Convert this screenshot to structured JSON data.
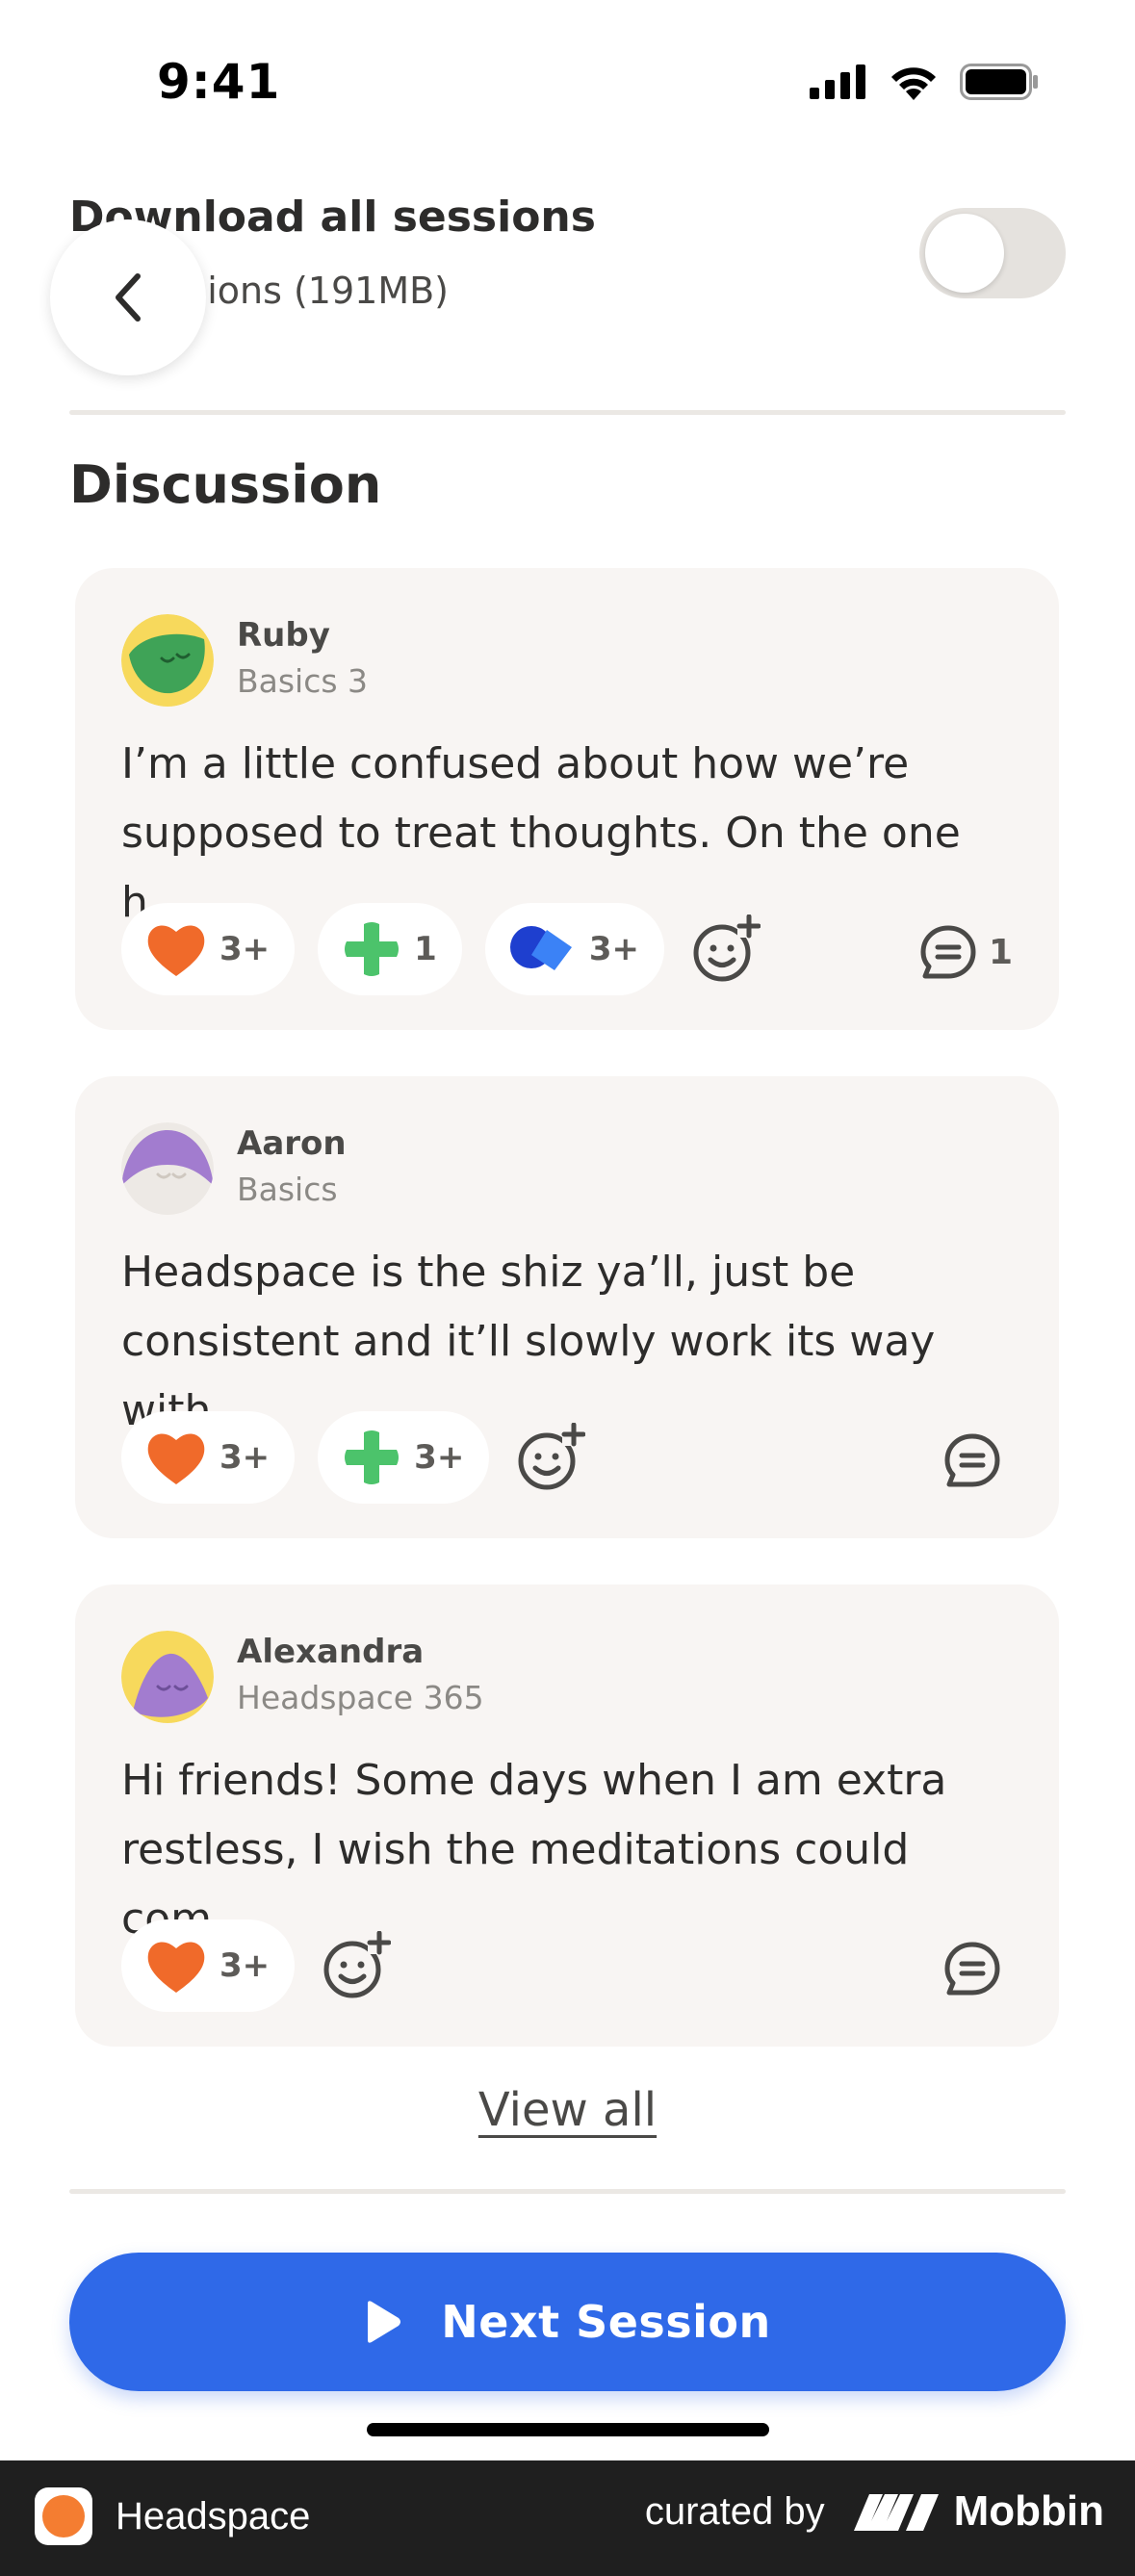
{
  "status_bar": {
    "time": "9:41"
  },
  "download": {
    "title": "Download all sessions",
    "subtitle": "10 sessions (191MB)",
    "toggle_on": false
  },
  "discussion": {
    "title": "Discussion",
    "posts": [
      {
        "author": "Ruby",
        "course": "Basics 3",
        "text": "I’m a little confused about how we’re supposed to treat thoughts. On the one h...",
        "reactions": [
          {
            "icon": "heart-icon",
            "count": "3+"
          },
          {
            "icon": "plus-icon",
            "count": "1"
          },
          {
            "icon": "shapes-icon",
            "count": "3+"
          }
        ],
        "comment_count": "1"
      },
      {
        "author": "Aaron",
        "course": "Basics",
        "text": "Headspace is the shiz ya’ll, just be consistent and it’ll slowly work its way with...",
        "reactions": [
          {
            "icon": "heart-icon",
            "count": "3+"
          },
          {
            "icon": "plus-icon",
            "count": "3+"
          }
        ],
        "comment_count": ""
      },
      {
        "author": "Alexandra",
        "course": "Headspace 365",
        "text": "Hi friends! Some days when I am extra restless, I wish the meditations could com...",
        "reactions": [
          {
            "icon": "heart-icon",
            "count": "3+"
          }
        ],
        "comment_count": ""
      }
    ],
    "view_all_label": "View all"
  },
  "cta": {
    "next_session_label": "Next Session"
  },
  "footer": {
    "app_name": "Headspace",
    "curated_by": "curated by",
    "brand": "Mobbin"
  },
  "colors": {
    "primary_blue": "#2f69e8",
    "heart_orange": "#f06a2a",
    "plus_green": "#4cc36b",
    "card_bg": "#f8f5f3"
  }
}
